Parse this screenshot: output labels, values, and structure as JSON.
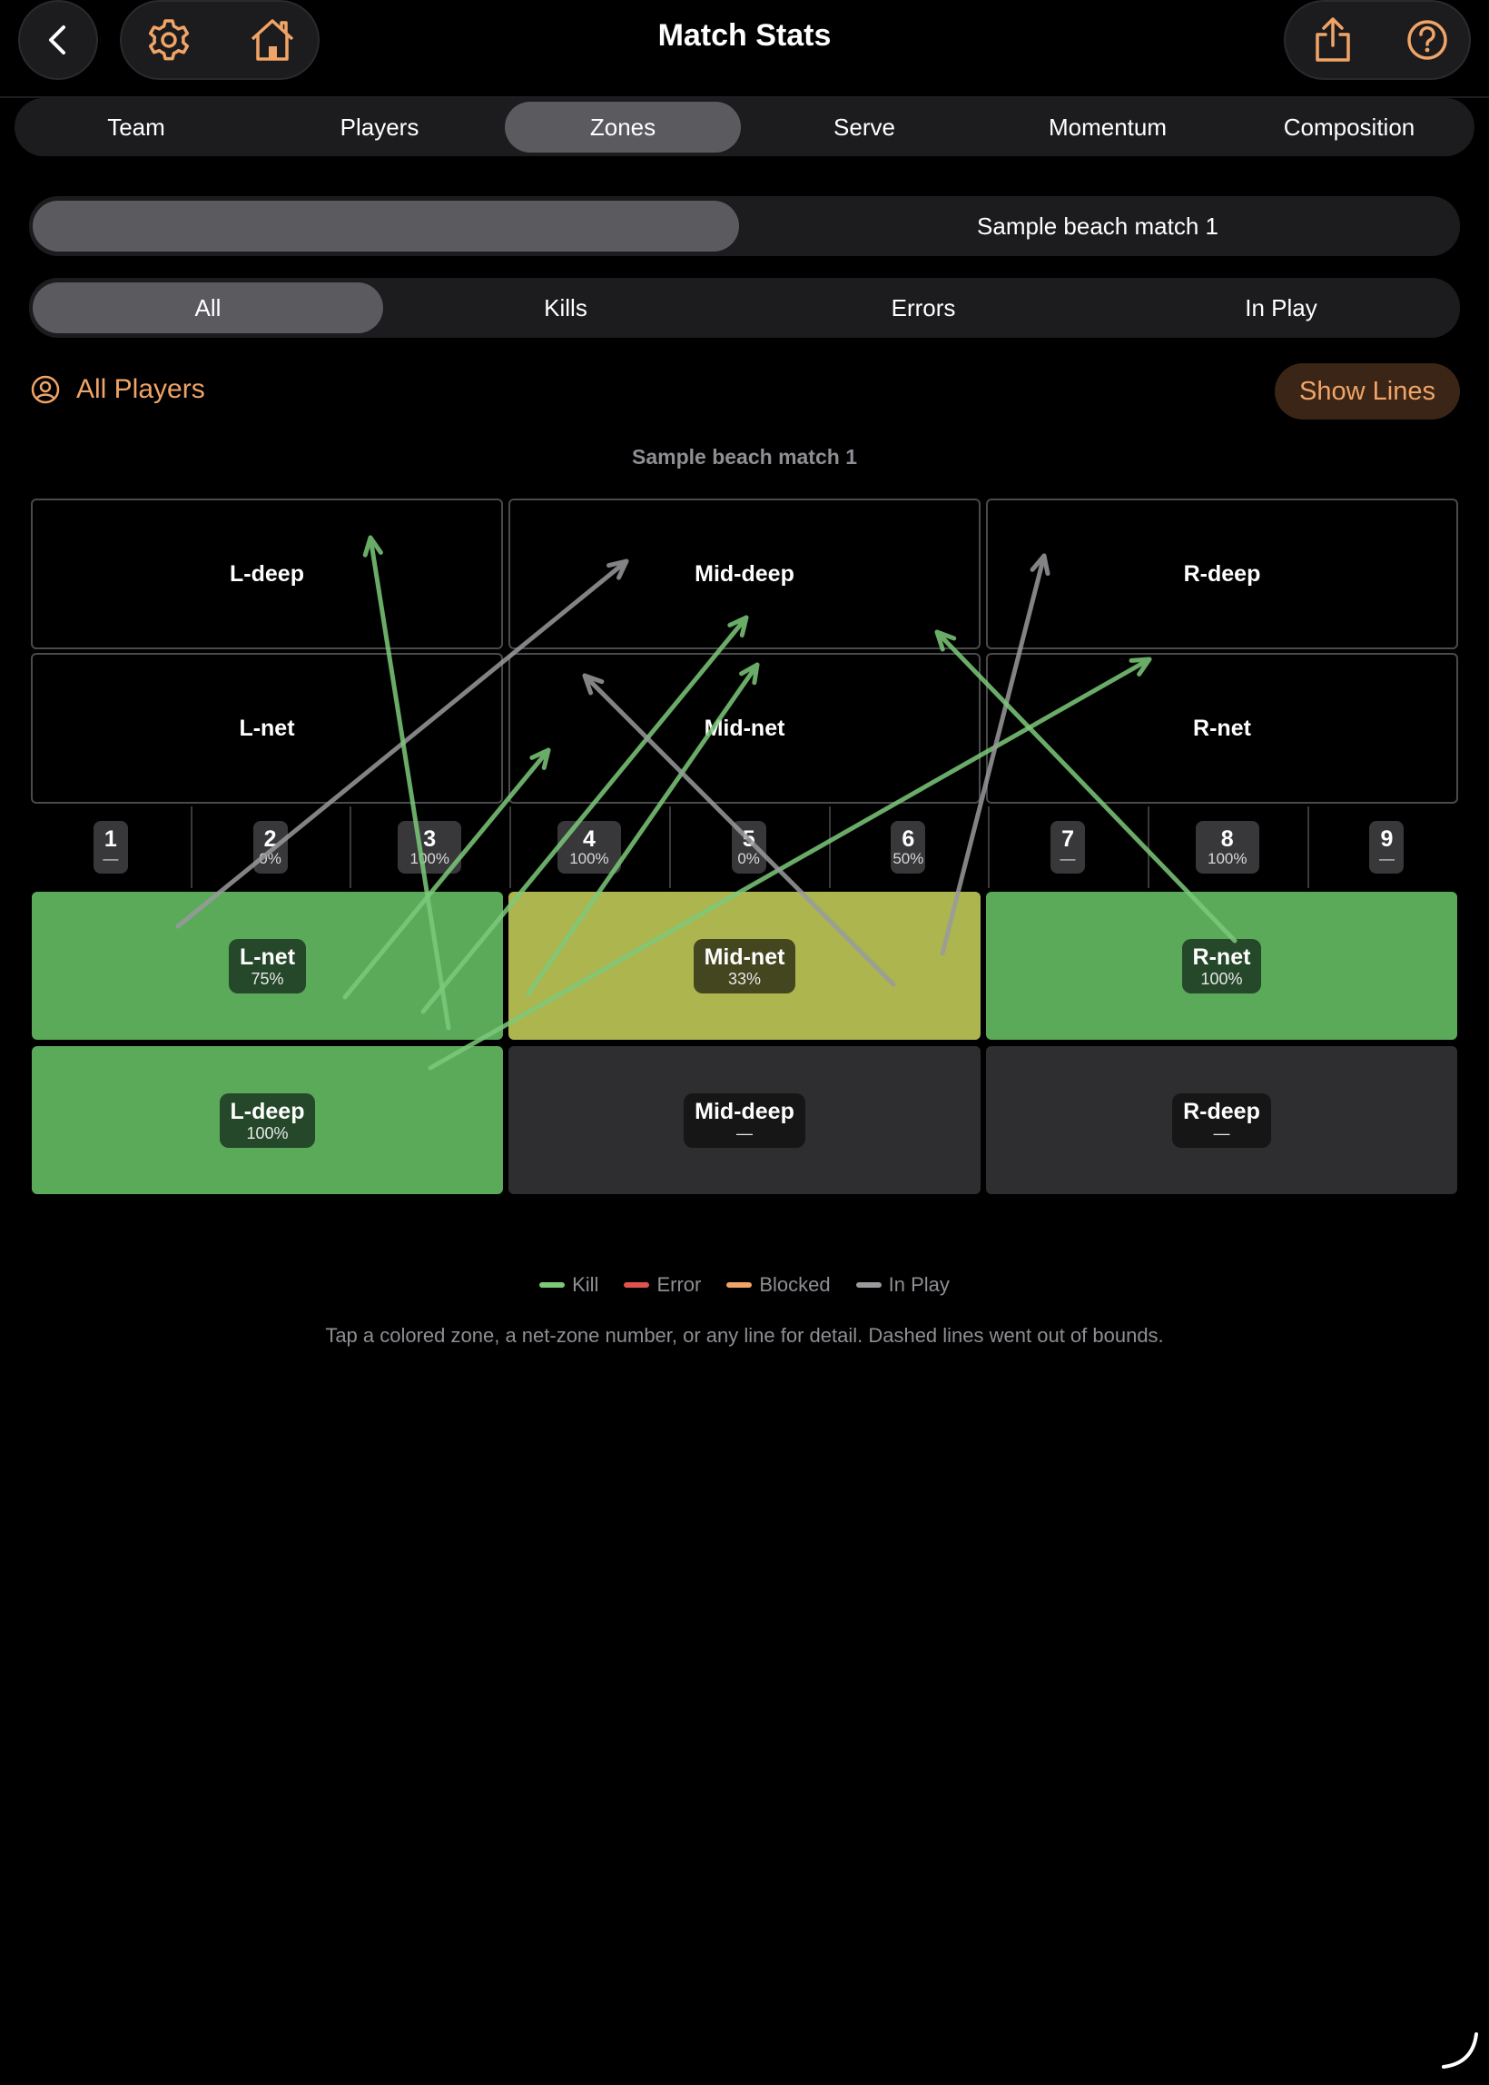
{
  "header": {
    "title": "Match Stats",
    "icons": {
      "back": "chevron-left-icon",
      "settings": "gear-icon",
      "home": "house-icon",
      "share": "share-icon",
      "help": "question-circle-icon"
    }
  },
  "tabs": [
    {
      "label": "Team",
      "active": false
    },
    {
      "label": "Players",
      "active": false
    },
    {
      "label": "Zones",
      "active": true
    },
    {
      "label": "Serve",
      "active": false
    },
    {
      "label": "Momentum",
      "active": false
    },
    {
      "label": "Composition",
      "active": false
    }
  ],
  "match_picker": {
    "options": [
      "",
      "Sample beach match 1"
    ],
    "selected_index": 0
  },
  "filters": [
    {
      "label": "All",
      "active": true
    },
    {
      "label": "Kills",
      "active": false
    },
    {
      "label": "Errors",
      "active": false
    },
    {
      "label": "In Play",
      "active": false
    }
  ],
  "player_filter": {
    "label": "All Players",
    "icon": "person-circle-icon"
  },
  "show_lines_label": "Show Lines",
  "chart_title": "Sample beach match 1",
  "opponent_zones": [
    {
      "label": "L-deep"
    },
    {
      "label": "Mid-deep"
    },
    {
      "label": "R-deep"
    },
    {
      "label": "L-net"
    },
    {
      "label": "Mid-net"
    },
    {
      "label": "R-net"
    }
  ],
  "net_zones": [
    {
      "n": "1",
      "pct": "—"
    },
    {
      "n": "2",
      "pct": "0%"
    },
    {
      "n": "3",
      "pct": "100%"
    },
    {
      "n": "4",
      "pct": "100%"
    },
    {
      "n": "5",
      "pct": "0%"
    },
    {
      "n": "6",
      "pct": "50%"
    },
    {
      "n": "7",
      "pct": "—"
    },
    {
      "n": "8",
      "pct": "100%"
    },
    {
      "n": "9",
      "pct": "—"
    }
  ],
  "heat_zones": [
    {
      "label": "L-net",
      "pct": "75%",
      "color": "#5aaa59"
    },
    {
      "label": "Mid-net",
      "pct": "33%",
      "color": "#adb54f"
    },
    {
      "label": "R-net",
      "pct": "100%",
      "color": "#5aaa59"
    },
    {
      "label": "L-deep",
      "pct": "100%",
      "color": "#5aaa59"
    },
    {
      "label": "Mid-deep",
      "pct": "—",
      "color": "#2e2e30"
    },
    {
      "label": "R-deep",
      "pct": "—",
      "color": "#2e2e30"
    }
  ],
  "colors": {
    "kill": "#7cc97a",
    "error": "#e0524f",
    "blocked": "#f0a467",
    "in_play": "#9a9a9e",
    "accent": "#f0a467"
  },
  "legend": [
    {
      "label": "Kill",
      "color": "#7cc97a"
    },
    {
      "label": "Error",
      "color": "#e0524f"
    },
    {
      "label": "Blocked",
      "color": "#f0a467"
    },
    {
      "label": "In Play",
      "color": "#9a9a9e"
    }
  ],
  "attack_lines": [
    {
      "outcome": "in_play"
    },
    {
      "outcome": "kill"
    },
    {
      "outcome": "kill"
    },
    {
      "outcome": "kill"
    },
    {
      "outcome": "kill"
    },
    {
      "outcome": "kill"
    },
    {
      "outcome": "in_play"
    },
    {
      "outcome": "in_play"
    },
    {
      "outcome": "kill"
    }
  ],
  "hint": "Tap a colored zone, a net-zone number, or any line for detail. Dashed lines went out of bounds."
}
